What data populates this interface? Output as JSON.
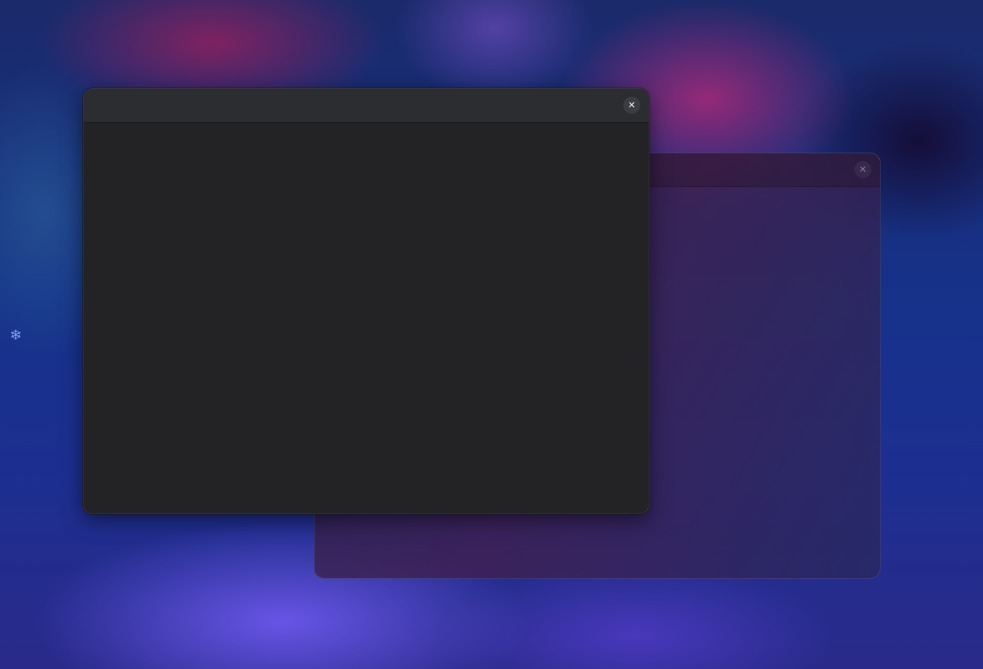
{
  "desktop": {
    "wallpaper_accent": "#1c2f90",
    "decoration_icon": "snowflake-icon",
    "decoration_glyph": "❄"
  },
  "windows": [
    {
      "name": "back-window",
      "close_icon": "close-icon",
      "close_glyph": "✕",
      "body_color": "#2a1f3a"
    },
    {
      "name": "front-window",
      "close_icon": "close-icon",
      "close_glyph": "✕",
      "body_color": "#232325"
    }
  ]
}
